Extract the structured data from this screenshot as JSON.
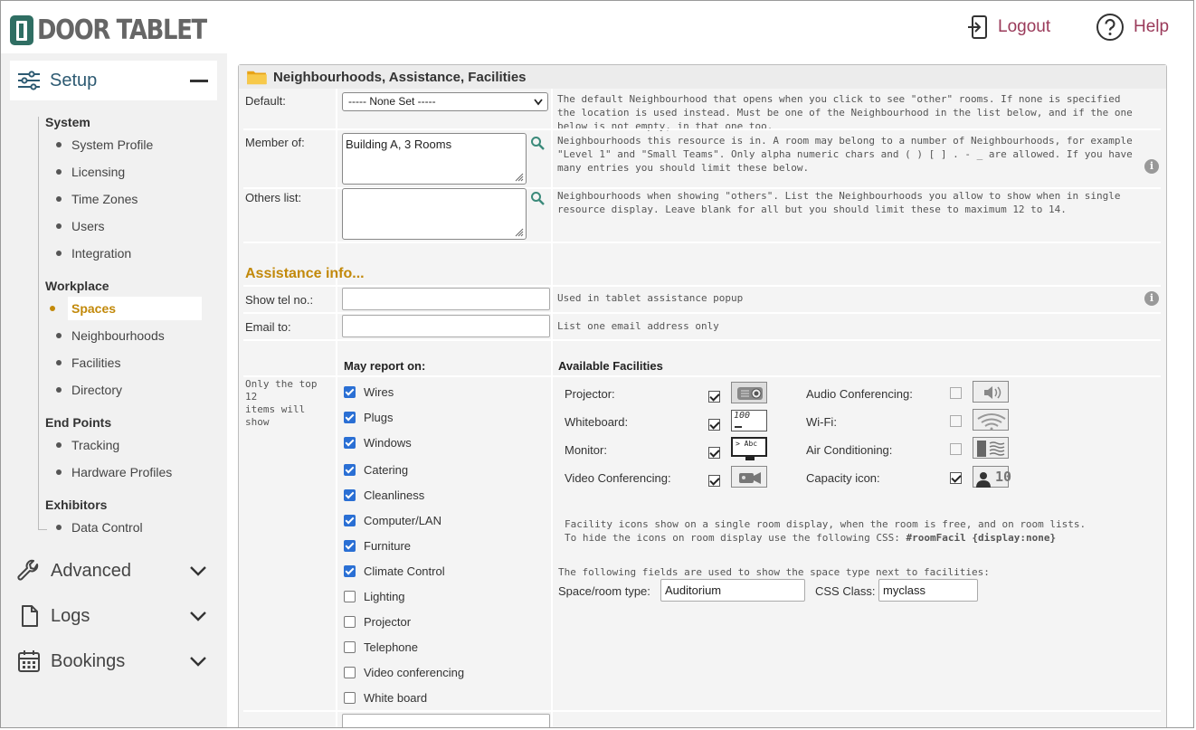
{
  "brand": {
    "name": "DOOR TABLET",
    "logo_color": "#2f6e63"
  },
  "header": {
    "logout": {
      "label": "Logout",
      "icon": "logout-icon"
    },
    "help": {
      "label": "Help",
      "icon": "help-icon"
    },
    "link_color": "#9a3a5a"
  },
  "sidebar": {
    "setup": {
      "label": "Setup",
      "icon": "sliders-icon"
    },
    "groups": {
      "system": "System",
      "workplace": "Workplace",
      "endpoints": "End Points",
      "exhibitors": "Exhibitors"
    },
    "items": {
      "system_profile": "System Profile",
      "licensing": "Licensing",
      "time_zones": "Time Zones",
      "users": "Users",
      "integration": "Integration",
      "spaces": "Spaces",
      "neighbourhoods": "Neighbourhoods",
      "facilities": "Facilities",
      "directory": "Directory",
      "tracking": "Tracking",
      "hardware_profiles": "Hardware Profiles",
      "data_control": "Data Control"
    },
    "sections": {
      "advanced": "Advanced",
      "logs": "Logs",
      "bookings": "Bookings"
    },
    "active_color": "#c2890a"
  },
  "panel": {
    "title": "Neighbourhoods, Assistance, Facilities",
    "default": {
      "label": "Default:",
      "value": "----- None Set -----",
      "desc": [
        "The default Neighbourhood that opens when you click to see \"other\" rooms. If none is specified",
        "the location is used instead. Must be one of the Neighbourhood in the list below, and if the one",
        "below is not empty, in that one too."
      ]
    },
    "member_of": {
      "label": "Member of:",
      "value": "Building A, 3 Rooms",
      "desc": [
        "Neighbourhoods this resource is in. A room may belong to a number of Neighbourhoods, for example",
        "\"Level 1\" and \"Small Teams\". Only alpha numeric chars and ( ) [ ] . - _ are allowed. If you have",
        "many entries you should limit these below."
      ]
    },
    "others_list": {
      "label": "Others list:",
      "value": "",
      "desc": [
        "Neighbourhoods when showing \"others\". List the Neighbourhoods you allow to show when in single",
        "resource display. Leave blank for all but you should limit these to maximum 12 to 14."
      ]
    },
    "assistance": {
      "title": "Assistance info...",
      "show_tel": {
        "label": "Show tel no.:",
        "value": "",
        "desc": "Used in tablet assistance popup"
      },
      "email_to": {
        "label": "Email to:",
        "value": "",
        "desc": "List one email address only"
      }
    },
    "report": {
      "note": [
        "Only the top",
        "12",
        "items will",
        "show"
      ],
      "heading": "May report on:",
      "items": [
        {
          "label": "Wires",
          "checked": true
        },
        {
          "label": "Plugs",
          "checked": true
        },
        {
          "label": "Windows",
          "checked": true
        },
        {
          "label": "Catering",
          "checked": true
        },
        {
          "label": "Cleanliness",
          "checked": true
        },
        {
          "label": "Computer/LAN",
          "checked": true
        },
        {
          "label": "Furniture",
          "checked": true
        },
        {
          "label": "Climate Control",
          "checked": true
        },
        {
          "label": "Lighting",
          "checked": false
        },
        {
          "label": "Projector",
          "checked": false
        },
        {
          "label": "Telephone",
          "checked": false
        },
        {
          "label": "Video conferencing",
          "checked": false
        },
        {
          "label": "White board",
          "checked": false
        }
      ]
    },
    "facilities": {
      "heading": "Available Facilities",
      "left": [
        {
          "label": "Projector:",
          "checked": true,
          "icon": "projector-icon"
        },
        {
          "label": "Whiteboard:",
          "checked": true,
          "icon": "whiteboard-icon"
        },
        {
          "label": "Monitor:",
          "checked": true,
          "icon": "monitor-icon"
        },
        {
          "label": "Video Conferencing:",
          "checked": true,
          "icon": "video-camera-icon"
        }
      ],
      "right": [
        {
          "label": "Audio Conferencing:",
          "checked": false,
          "icon": "speaker-icon"
        },
        {
          "label": "Wi-Fi:",
          "checked": false,
          "icon": "wifi-icon"
        },
        {
          "label": "Air Conditioning:",
          "checked": false,
          "icon": "air-conditioning-icon"
        },
        {
          "label": "Capacity icon:",
          "checked": true,
          "icon": "person-capacity-icon"
        }
      ],
      "whiteboard_text": "100",
      "monitor_text": "> Abc",
      "capacity_value": "10",
      "note": [
        "Facility icons show on a single room display, when the room is free, and on room lists.",
        "To hide the icons on room display use the following CSS: "
      ],
      "note_code": "#roomFacil {display:none}",
      "space_type_note": "The following fields are used to show the space type next to facilities:",
      "space_type": {
        "label": "Space/room type:",
        "value": "Auditorium"
      },
      "css_class": {
        "label": "CSS Class:",
        "value": "myclass"
      }
    }
  }
}
